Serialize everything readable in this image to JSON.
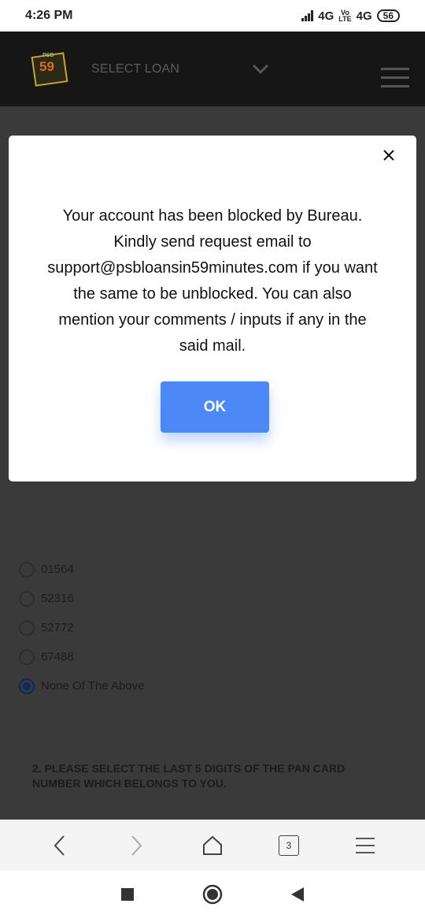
{
  "status_bar": {
    "time": "4:26 PM",
    "network1": "4G",
    "volte_top": "Vo",
    "volte_bottom": "LTE",
    "network2": "4G",
    "battery": "56"
  },
  "header": {
    "logo_number": "59",
    "logo_small": "PSB",
    "select_label": "SELECT LOAN"
  },
  "options": [
    {
      "label": "01564",
      "checked": false
    },
    {
      "label": "52316",
      "checked": false
    },
    {
      "label": "52772",
      "checked": false
    },
    {
      "label": "67488",
      "checked": false
    },
    {
      "label": "None Of The Above",
      "checked": true
    }
  ],
  "question": "2. PLEASE SELECT THE LAST 5 DIGITS OF THE PAN CARD NUMBER WHICH BELONGS TO YOU.",
  "modal": {
    "message": "Your account has been blocked by Bureau. Kindly send request email to support@psbloansin59minutes.com if you want the same to be unblocked. You can also mention your comments / inputs if any in the said mail.",
    "ok_label": "OK"
  },
  "browser_bar": {
    "tab_count": "3"
  },
  "colors": {
    "overlay": "#3a3a3a",
    "ok_button": "#4d88f7",
    "header_bg": "#161616"
  }
}
